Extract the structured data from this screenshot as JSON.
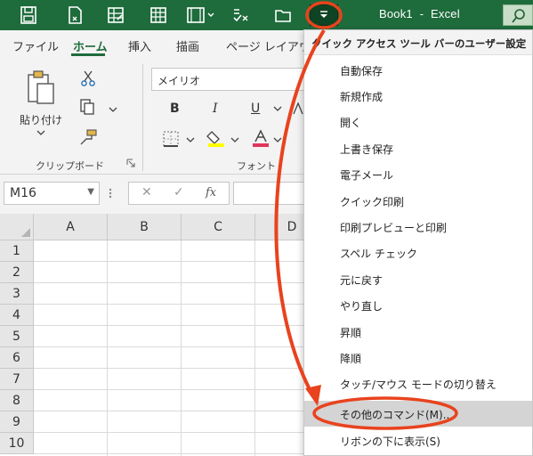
{
  "titlebar": {
    "book": "Book1",
    "dash": "-",
    "app": "Excel",
    "icons": [
      "autosave-icon",
      "new-document-icon",
      "spreadsheet-icon",
      "table-icon",
      "film-strip-icon",
      "spell-check-icon",
      "folder-open-icon",
      "qat-dropdown-icon"
    ]
  },
  "tabs": [
    {
      "label": "ファイル"
    },
    {
      "label": "ホーム"
    },
    {
      "label": "挿入"
    },
    {
      "label": "描画"
    },
    {
      "label": "ページ レイアウト"
    }
  ],
  "ribbon": {
    "paste_label": "貼り付け",
    "clipboard_group": "クリップボード",
    "font_group": "フォント",
    "font_name": "メイリオ",
    "bold": "B",
    "italic": "I",
    "underline": "U"
  },
  "formula_bar": {
    "name_box": "M16",
    "fx": "fx"
  },
  "grid": {
    "columns": [
      "A",
      "B",
      "C",
      "D"
    ],
    "rows": [
      "1",
      "2",
      "3",
      "4",
      "5",
      "6",
      "7",
      "8",
      "9",
      "10"
    ]
  },
  "menu": {
    "header": "クイック アクセス ツール バーのユーザー設定",
    "items": [
      "自動保存",
      "新規作成",
      "開く",
      "上書き保存",
      "電子メール",
      "クイック印刷",
      "印刷プレビューと印刷",
      "スペル チェック",
      "元に戻す",
      "やり直し",
      "昇順",
      "降順",
      "タッチ/マウス モードの切り替え",
      "その他のコマンド(M)...",
      "リボンの下に表示(S)"
    ],
    "highlighted_index": 13
  },
  "colors": {
    "excel_green": "#1e6b3c",
    "annotation_red": "#e8431e",
    "menu_highlight": "#d4d4d4"
  }
}
